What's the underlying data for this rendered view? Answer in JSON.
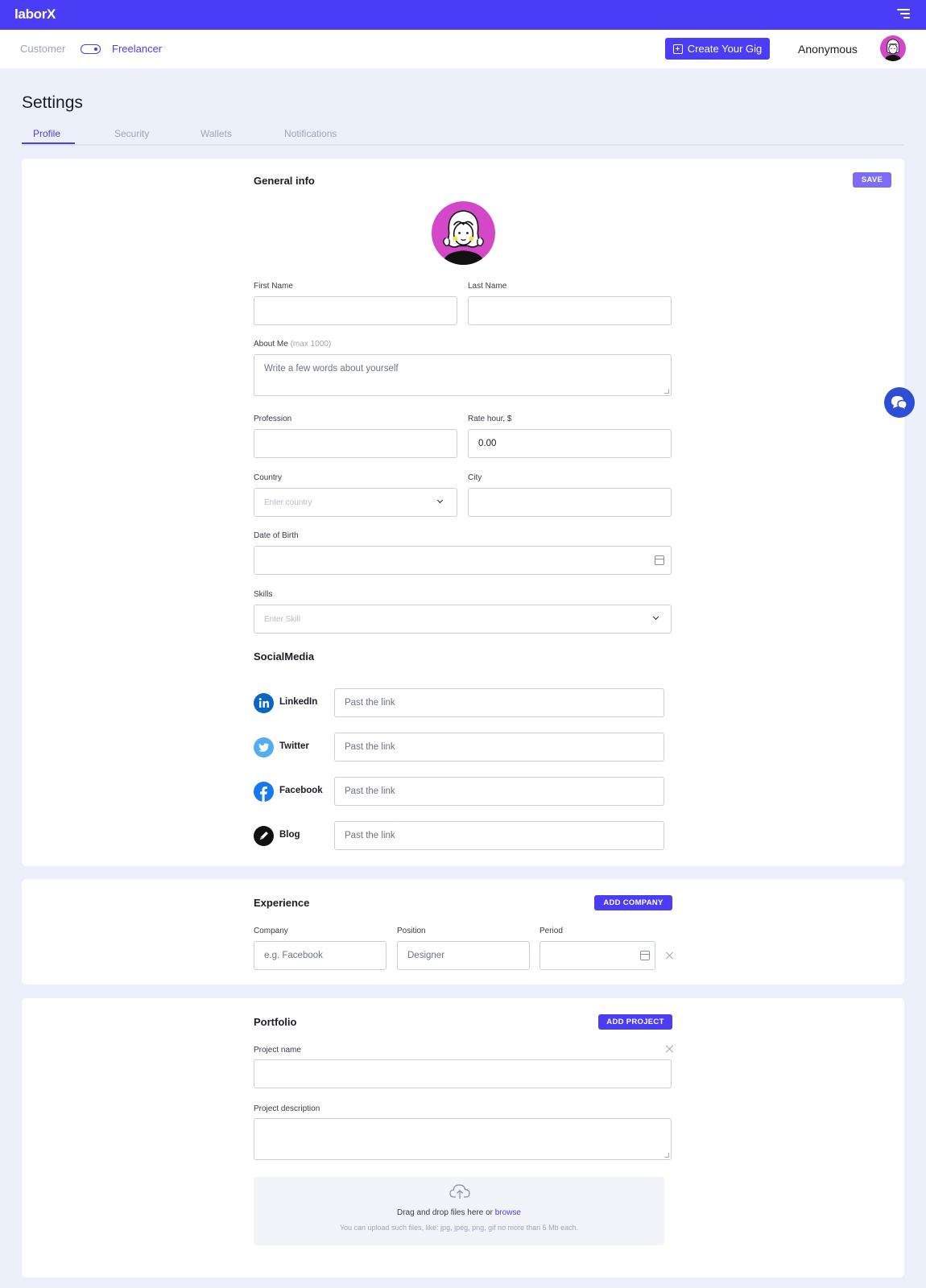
{
  "app": {
    "logo": "laborX"
  },
  "header": {
    "role_customer": "Customer",
    "role_freelancer": "Freelancer",
    "create_gig_label": "Create Your Gig",
    "user_name": "Anonymous"
  },
  "page": {
    "title": "Settings",
    "tabs": [
      {
        "label": "Profile",
        "active": true
      },
      {
        "label": "Security",
        "active": false
      },
      {
        "label": "Wallets",
        "active": false
      },
      {
        "label": "Notifications",
        "active": false
      }
    ]
  },
  "general": {
    "title": "General info",
    "save_label": "SAVE",
    "first_name_label": "First Name",
    "first_name_value": "",
    "last_name_label": "Last Name",
    "last_name_value": "",
    "about_label": "About Me",
    "about_hint": "(max 1000)",
    "about_placeholder": "Write a few words about yourself",
    "profession_label": "Profession",
    "profession_value": "",
    "rate_label": "Rate hour, $",
    "rate_value": "0.00",
    "country_label": "Country",
    "country_placeholder": "Enter country",
    "city_label": "City",
    "city_value": "",
    "dob_label": "Date of Birth",
    "dob_value": "",
    "skills_label": "Skills",
    "skills_placeholder": "Enter Skill"
  },
  "social": {
    "title": "SocialMedia",
    "items": [
      {
        "name": "LinkedIn",
        "placeholder": "Past the link",
        "icon": "linkedin-icon",
        "color": "#0a66c2"
      },
      {
        "name": "Twitter",
        "placeholder": "Past the link",
        "icon": "twitter-icon",
        "color": "#55acee"
      },
      {
        "name": "Facebook",
        "placeholder": "Past the link",
        "icon": "facebook-icon",
        "color": "#1877f2"
      },
      {
        "name": "Blog",
        "placeholder": "Past the link",
        "icon": "pencil-icon",
        "color": "#111111"
      }
    ]
  },
  "experience": {
    "title": "Experience",
    "add_label": "ADD COMPANY",
    "company_label": "Company",
    "company_placeholder": "e.g. Facebook",
    "position_label": "Position",
    "position_placeholder": "Designer",
    "period_label": "Period",
    "period_value": ""
  },
  "portfolio": {
    "title": "Portfolio",
    "add_label": "ADD PROJECT",
    "name_label": "Project name",
    "name_value": "",
    "description_label": "Project description",
    "description_value": "",
    "drop_text": "Drag and drop files here or",
    "drop_link": "browse",
    "drop_hint": "You can upload such files, like: jpg, jpeg, png, gif no more than 5 Mb each."
  },
  "colors": {
    "accent": "#4b3cf5",
    "background": "#ecf0fa",
    "avatar": "#d348c6",
    "chat": "#2d4fd6"
  }
}
